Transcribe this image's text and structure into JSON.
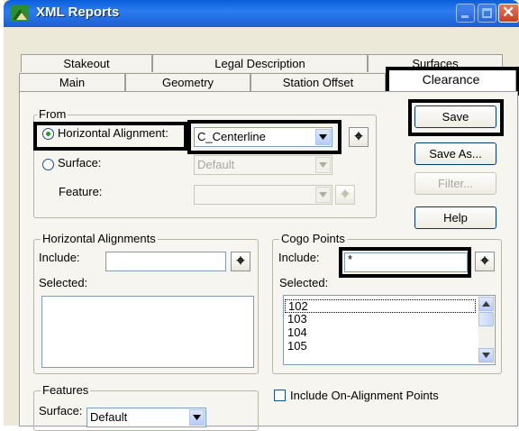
{
  "window": {
    "title": "XML Reports"
  },
  "tabs_back": [
    "Stakeout",
    "Legal Description",
    "Surfaces"
  ],
  "tabs_front": [
    "Main",
    "Geometry",
    "Station Offset",
    "Clearance"
  ],
  "from": {
    "legend": "From",
    "horizontal_alignment_label": "Horizontal Alignment:",
    "horizontal_alignment_value": "C_Centerline",
    "surface_label": "Surface:",
    "surface_value": "Default",
    "feature_label": "Feature:",
    "feature_value": "",
    "selected_option": "Horizontal Alignment"
  },
  "buttons": {
    "save": "Save",
    "save_as": "Save As...",
    "filter": "Filter...",
    "help": "Help"
  },
  "horizontal_alignments": {
    "legend": "Horizontal Alignments",
    "include_label": "Include:",
    "include_value": "",
    "selected_label": "Selected:",
    "items": []
  },
  "cogo_points": {
    "legend": "Cogo Points",
    "include_label": "Include:",
    "include_value": "*",
    "selected_label": "Selected:",
    "items": [
      "102",
      "103",
      "104",
      "105"
    ]
  },
  "include_on_alignment": {
    "label": "Include On-Alignment Points",
    "checked": false
  },
  "features": {
    "legend": "Features",
    "surface_label": "Surface:",
    "surface_value": "Default"
  },
  "icons": {
    "pick": "target-pick-icon",
    "dropdown": "chevron-down-icon"
  }
}
